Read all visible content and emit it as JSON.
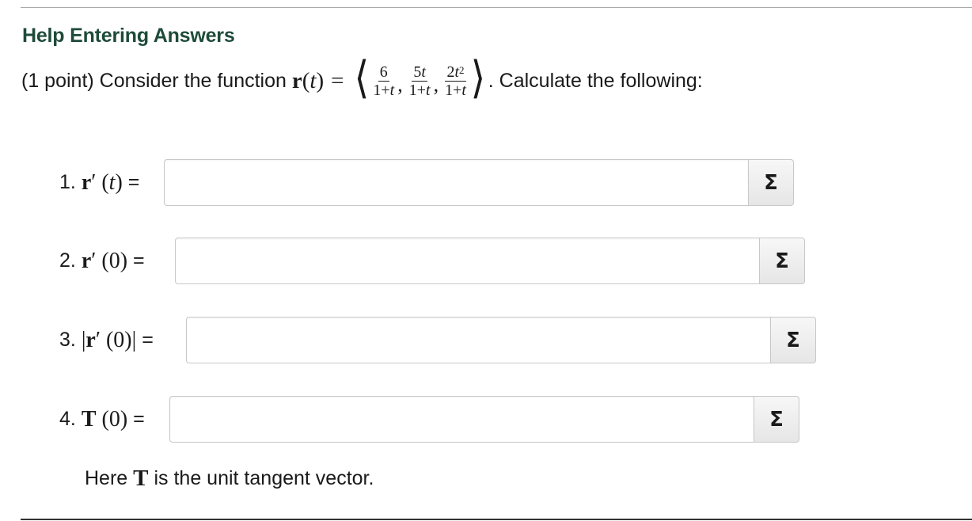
{
  "header": {
    "help_link": "Help Entering Answers"
  },
  "problem": {
    "prefix": "(1 point) Consider the function",
    "function_name": "r",
    "open_paren": "(",
    "variable": "t",
    "close_paren": ")",
    "equals": "=",
    "components": [
      {
        "num_coef": "6",
        "num_var": "",
        "num_exp": "",
        "den": "1+t"
      },
      {
        "num_coef": "5",
        "num_var": "t",
        "num_exp": "",
        "den": "1+t"
      },
      {
        "num_coef": "2",
        "num_var": "t",
        "num_exp": "2",
        "den": "1+t"
      }
    ],
    "suffix": ". Calculate the following:"
  },
  "questions": [
    {
      "number": "1.",
      "lead": "",
      "vec": "r",
      "prime": "′",
      "arg": "(t)",
      "trail": "",
      "eq": "=",
      "value": "",
      "button": "Σ"
    },
    {
      "number": "2.",
      "lead": "",
      "vec": "r",
      "prime": "′",
      "arg": " (0)",
      "trail": "",
      "eq": "=",
      "value": "",
      "button": "Σ"
    },
    {
      "number": "3.",
      "lead": "|",
      "vec": "r",
      "prime": "′",
      "arg": " (0)",
      "trail": "|",
      "eq": "=",
      "value": "",
      "button": "Σ"
    },
    {
      "number": "4.",
      "lead": "",
      "vec": "T",
      "prime": "",
      "arg": " (0)",
      "trail": "",
      "eq": "=",
      "value": "",
      "button": "Σ"
    }
  ],
  "note": {
    "prefix": "Here",
    "symbol": "T",
    "suffix": "is the unit tangent vector."
  }
}
